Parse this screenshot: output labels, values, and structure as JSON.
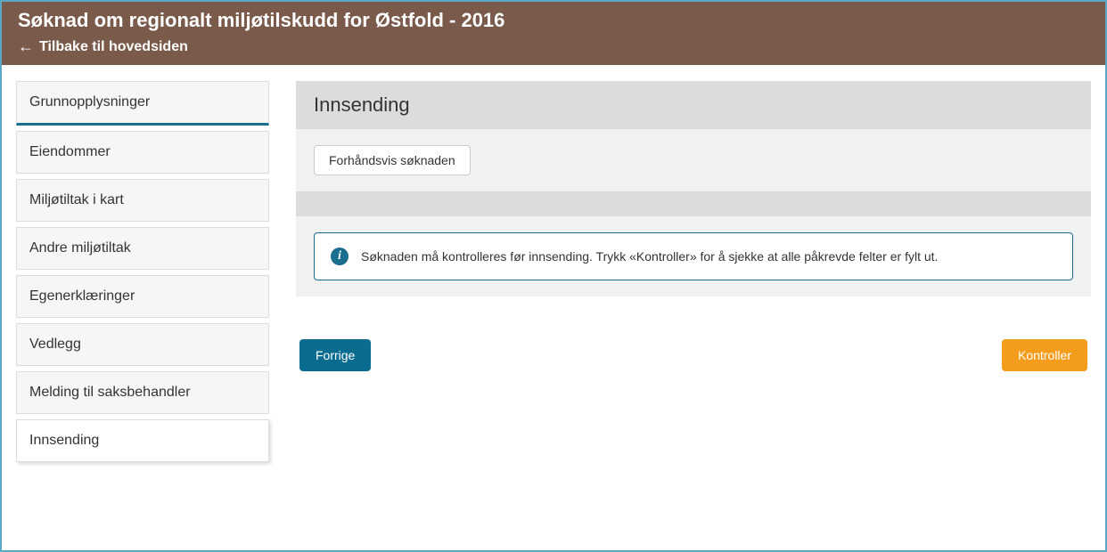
{
  "header": {
    "title": "Søknad om regionalt miljøtilskudd for Østfold - 2016",
    "back_link": "Tilbake til hovedsiden"
  },
  "sidebar": {
    "items": [
      {
        "label": "Grunnopplysninger"
      },
      {
        "label": "Eiendommer"
      },
      {
        "label": "Miljøtiltak i kart"
      },
      {
        "label": "Andre miljøtiltak"
      },
      {
        "label": "Egenerklæringer"
      },
      {
        "label": "Vedlegg"
      },
      {
        "label": "Melding til saksbehandler"
      },
      {
        "label": "Innsending"
      }
    ]
  },
  "main": {
    "panel_title": "Innsending",
    "preview_button": "Forhåndsvis søknaden",
    "info_message": "Søknaden må kontrolleres før innsending. Trykk «Kontroller» for å sjekke at alle påkrevde felter er fylt ut.",
    "prev_button": "Forrige",
    "kontroller_button": "Kontroller"
  }
}
